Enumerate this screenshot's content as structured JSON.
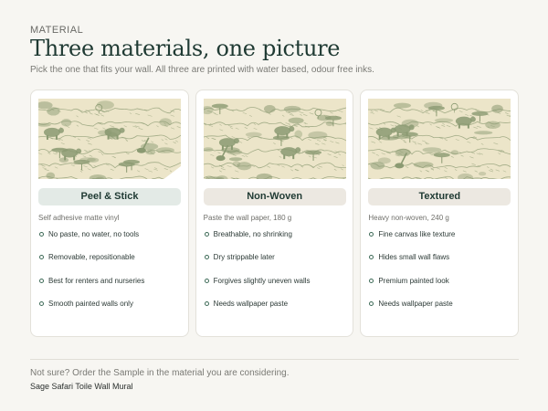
{
  "header": {
    "eyebrow": "MATERIAL",
    "title": "Three materials, one picture",
    "subtitle": "Pick the one that fits your wall. All three are printed with water based, odour free inks."
  },
  "colors": {
    "accent_dark": "#1f3a33",
    "pill_green": "#e3eae6",
    "pill_beige": "#ece8e1",
    "toile_background": "#ece5c9",
    "toile_ink": "#8b9a72"
  },
  "materials": [
    {
      "name": "Peel & Stick",
      "spec": "Self adhesive matte vinyl",
      "features": [
        "No paste, no water, no tools",
        "Removable, repositionable",
        "Best for renters and nurseries",
        "Smooth painted walls only"
      ]
    },
    {
      "name": "Non-Woven",
      "spec": "Paste the wall paper, 180 g",
      "features": [
        "Breathable, no shrinking",
        "Dry strippable later",
        "Forgives slightly uneven walls",
        "Needs wallpaper paste"
      ]
    },
    {
      "name": "Textured",
      "spec": "Heavy non-woven, 240 g",
      "features": [
        "Fine canvas like texture",
        "Hides small wall flaws",
        "Premium painted look",
        "Needs wallpaper paste"
      ]
    }
  ],
  "footer": {
    "note": "Not sure? Order the Sample in the material you are considering.",
    "product": "Sage Safari Toile Wall Mural"
  }
}
